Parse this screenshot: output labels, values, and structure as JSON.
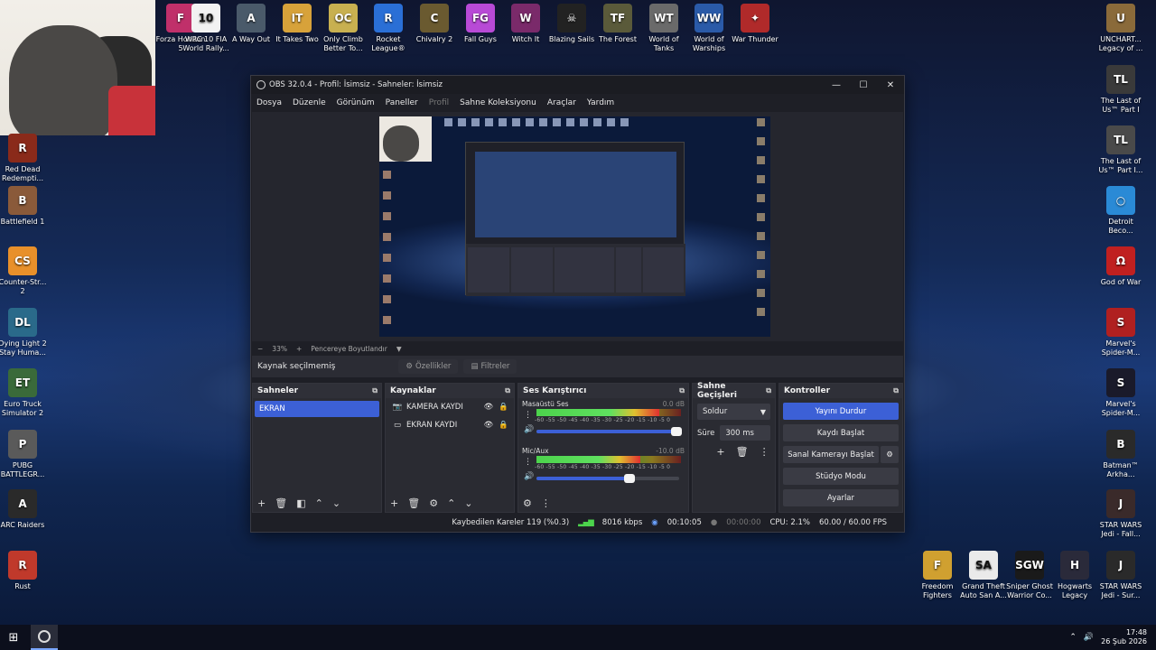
{
  "desktop": {
    "top_icons": [
      {
        "label": "Forza Horizon 5",
        "color": "#c0306a",
        "glyph": "F"
      },
      {
        "label": "WRC 10 FIA World Rally...",
        "color": "#f2f2f2",
        "glyph": "10"
      },
      {
        "label": "A Way Out",
        "color": "#4a5a6a",
        "glyph": "A"
      },
      {
        "label": "It Takes Two",
        "color": "#d7a23a",
        "glyph": "IT"
      },
      {
        "label": "Only Climb Better To...",
        "color": "#c8b050",
        "glyph": "OC"
      },
      {
        "label": "Rocket League®",
        "color": "#2a6fd6",
        "glyph": "R"
      },
      {
        "label": "Chivalry 2",
        "color": "#6a5a30",
        "glyph": "C"
      },
      {
        "label": "Fall Guys",
        "color": "#b84ad6",
        "glyph": "FG"
      },
      {
        "label": "Witch It",
        "color": "#7a2a6a",
        "glyph": "W"
      },
      {
        "label": "Blazing Sails",
        "color": "#222222",
        "glyph": "☠"
      },
      {
        "label": "The Forest",
        "color": "#5a5a3a",
        "glyph": "TF"
      },
      {
        "label": "World of Tanks",
        "color": "#6a6a6a",
        "glyph": "WT"
      },
      {
        "label": "World of Warships",
        "color": "#2a5aa8",
        "glyph": "WW"
      },
      {
        "label": "War Thunder",
        "color": "#b02a2a",
        "glyph": "✦"
      }
    ],
    "left_icons": [
      {
        "label": "Red Dead Redempti...",
        "color": "#8a2a1a",
        "glyph": "R"
      },
      {
        "label": "Battlefield 1",
        "color": "#8a5a3a",
        "glyph": "B"
      },
      {
        "label": "Counter-Str... 2",
        "color": "#e8902a",
        "glyph": "CS"
      },
      {
        "label": "Dying Light 2 Stay Huma...",
        "color": "#2a6a8a",
        "glyph": "DL"
      },
      {
        "label": "Euro Truck Simulator 2",
        "color": "#3a6a3a",
        "glyph": "ET"
      },
      {
        "label": "PUBG BATTLEGR...",
        "color": "#5a5a5a",
        "glyph": "P"
      },
      {
        "label": "ARC Raiders",
        "color": "#2a2a2a",
        "glyph": "A"
      },
      {
        "label": "Rust",
        "color": "#c0392b",
        "glyph": "R"
      }
    ],
    "right_icons": [
      {
        "label": "UNCHART... Legacy of ...",
        "color": "#8a6a3a",
        "glyph": "U"
      },
      {
        "label": "The Last of Us™ Part I",
        "color": "#3a3a3a",
        "glyph": "TL"
      },
      {
        "label": "The Last of Us™ Part I...",
        "color": "#4a4a4a",
        "glyph": "TL"
      },
      {
        "label": "Detroit Beco...",
        "color": "#2a8ad6",
        "glyph": "○"
      },
      {
        "label": "God of War",
        "color": "#c02020",
        "glyph": "Ω"
      },
      {
        "label": "Marvel's Spider-M...",
        "color": "#b02020",
        "glyph": "S"
      },
      {
        "label": "Marvel's Spider-M...",
        "color": "#1a1a2a",
        "glyph": "S"
      },
      {
        "label": "Batman™ Arkha...",
        "color": "#2a2a2a",
        "glyph": "B"
      },
      {
        "label": "STAR WARS Jedi - Fall...",
        "color": "#3a2a2a",
        "glyph": "J"
      }
    ],
    "bottom_icons": [
      {
        "label": "Freedom Fighters",
        "color": "#d0a030",
        "glyph": "F"
      },
      {
        "label": "Grand Theft Auto San A...",
        "color": "#eaeaea",
        "glyph": "SA"
      },
      {
        "label": "Sniper Ghost Warrior Co...",
        "color": "#1a1a1a",
        "glyph": "SGW"
      },
      {
        "label": "Hogwarts Legacy",
        "color": "#2a2a3a",
        "glyph": "H"
      },
      {
        "label": "STAR WARS Jedi - Sur...",
        "color": "#2a2a2a",
        "glyph": "J"
      }
    ]
  },
  "obs": {
    "title": "OBS 32.0.4 - Profil: İsimsiz - Sahneler: İsimsiz",
    "window_buttons": [
      "—",
      "☐",
      "✕"
    ],
    "menu": [
      "Dosya",
      "Düzenle",
      "Görünüm",
      "Paneller",
      "Profil",
      "Sahne Koleksiyonu",
      "Araçlar",
      "Yardım"
    ],
    "zoom": {
      "minus": "−",
      "value": "33%",
      "plus": "+",
      "fit_label": "Pencereye Boyutlandır",
      "caret": "▼"
    },
    "source_bar": {
      "status": "Kaynak seçilmemiş",
      "properties": "Özellikler",
      "filters": "Filtreler"
    },
    "scenes": {
      "title": "Sahneler",
      "items": [
        "EKRAN"
      ]
    },
    "sources": {
      "title": "Kaynaklar",
      "items": [
        {
          "label": "KAMERA KAYDI",
          "icon": "camera-icon"
        },
        {
          "label": "EKRAN KAYDI",
          "icon": "monitor-icon"
        }
      ]
    },
    "mixer": {
      "title": "Ses Karıştırıcı",
      "scale": "-60 -55 -50 -45 -40 -35 -30 -25 -20 -15 -10 -5 0",
      "tracks": [
        {
          "name": "Masaüstü Ses",
          "db": "0.0 dB",
          "level": 0.85,
          "volume": 0.98
        },
        {
          "name": "Mic/Aux",
          "db": "-10.0 dB",
          "level": 0.72,
          "volume": 0.65
        }
      ]
    },
    "transitions": {
      "title": "Sahne Geçişleri",
      "selected": "Soldur",
      "duration_label": "Süre",
      "duration": "300 ms"
    },
    "controls": {
      "title": "Kontroller",
      "buttons": [
        "Yayını Durdur",
        "Kaydı Başlat",
        "Sanal Kamerayı Başlat",
        "Stüdyo Modu",
        "Ayarlar"
      ]
    },
    "status": {
      "dropped_frames": "Kaybedilen Kareler 119 (%0.3)",
      "bitrate": "8016 kbps",
      "stream_time": "00:10:05",
      "rec_time": "00:00:00",
      "cpu": "CPU: 2.1%",
      "fps": "60.00 / 60.00 FPS"
    }
  },
  "taskbar": {
    "time": "17:48",
    "date": "26 Şub 2026"
  }
}
